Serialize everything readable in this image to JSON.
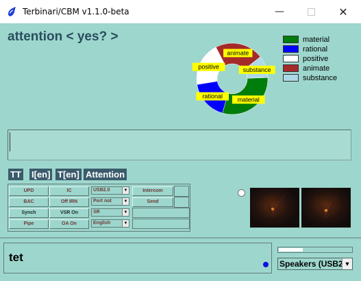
{
  "window": {
    "title": "Terbinari/CBM v1.1.0-beta",
    "minimize_glyph": "—",
    "close_glyph": "✕",
    "icon": "blue-drop-icon"
  },
  "header": {
    "attention": "attention < yes? >"
  },
  "chart_data": {
    "type": "pie",
    "style": "donut",
    "categories": [
      "material",
      "rational",
      "positive",
      "animate",
      "substance"
    ],
    "values": [
      30,
      18,
      20,
      22,
      10
    ],
    "colors": [
      "#007d0a",
      "#0000ff",
      "#ffffff",
      "#a52a2a",
      "#add8e6"
    ],
    "slice_labels": [
      "material",
      "rational",
      "positive",
      "animate",
      "substance"
    ],
    "legend": [
      "material",
      "rational",
      "positive",
      "animate",
      "substance"
    ],
    "legend_placement": "right"
  },
  "text_entry": {
    "value": ""
  },
  "tabs": [
    {
      "label": "TT"
    },
    {
      "label": "I[en]"
    },
    {
      "label": "T[en]"
    },
    {
      "label": "Attention"
    }
  ],
  "panel": {
    "buttons": {
      "upd": "UPD",
      "ic": "IC",
      "bac": "BAC",
      "off_irn": "Off IRN",
      "synch": "Synch",
      "vsr_on": "VSR On",
      "pipe": "Pipe",
      "oa_on": "OA On",
      "intercom": "Intercom",
      "send": "Send"
    },
    "selects": {
      "usb": "USB2.0",
      "port": "Port not",
      "sr": "SR",
      "language": "English"
    }
  },
  "footer": {
    "chat_text": "tet",
    "audio_level": 0.33,
    "speaker_select": "Speakers (USB2"
  }
}
